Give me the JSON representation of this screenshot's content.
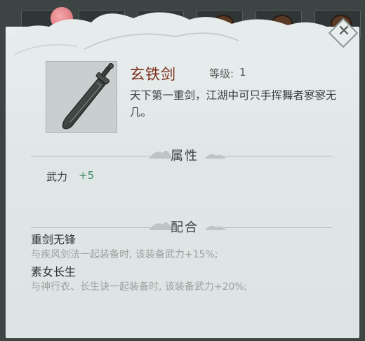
{
  "item": {
    "name": "玄铁剑",
    "level_label": "等级:",
    "level_value": "1",
    "description": "天下第一重剑，江湖中可只手挥舞者寥寥无几。",
    "image_icon": "heavy-iron-sword-icon"
  },
  "sections": {
    "attributes_title": "属性",
    "combo_title": "配合"
  },
  "attributes": [
    {
      "label": "武力",
      "value": "+5"
    }
  ],
  "combos": [
    {
      "name": "重剑无锋",
      "desc": "与疾风剑法一起装备时, 该装备武力+15%;"
    },
    {
      "name": "素女长生",
      "desc": "与神行衣、长生诀一起装备时, 该装备武力+20%;"
    }
  ],
  "colors": {
    "item_name": "#7c2a18",
    "stat_value": "#3c8a63",
    "panel_bg": "#e2e9e9"
  },
  "close_icon": "close-icon"
}
